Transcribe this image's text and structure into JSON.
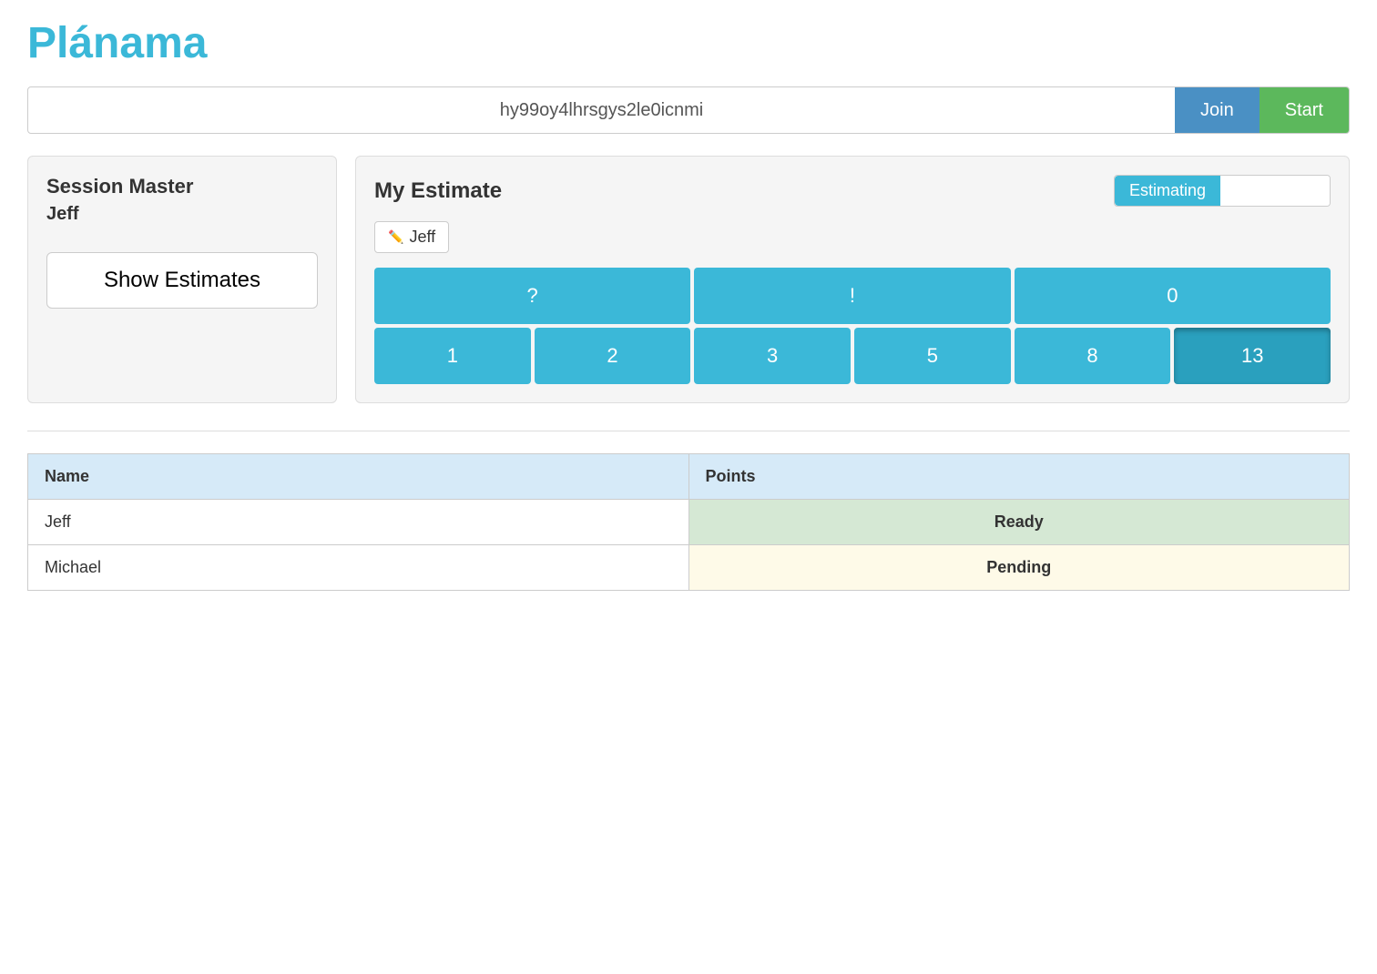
{
  "app": {
    "title": "Plánama"
  },
  "session_bar": {
    "session_id": "hy99oy4lhrsgys2le0icnmi",
    "join_label": "Join",
    "start_label": "Start"
  },
  "left_panel": {
    "session_master_label": "Session Master",
    "session_master_name": "Jeff",
    "show_estimates_label": "Show Estimates"
  },
  "right_panel": {
    "my_estimate_title": "My Estimate",
    "estimating_badge": "Estimating",
    "user_tag": "Jeff",
    "estimate_row1": [
      "?",
      "!",
      "0"
    ],
    "estimate_row2": [
      "1",
      "2",
      "3",
      "5",
      "8",
      "13"
    ],
    "selected_value": "13"
  },
  "table": {
    "name_header": "Name",
    "points_header": "Points",
    "rows": [
      {
        "name": "Jeff",
        "points": "Ready",
        "status": "ready"
      },
      {
        "name": "Michael",
        "points": "Pending",
        "status": "pending"
      }
    ]
  }
}
